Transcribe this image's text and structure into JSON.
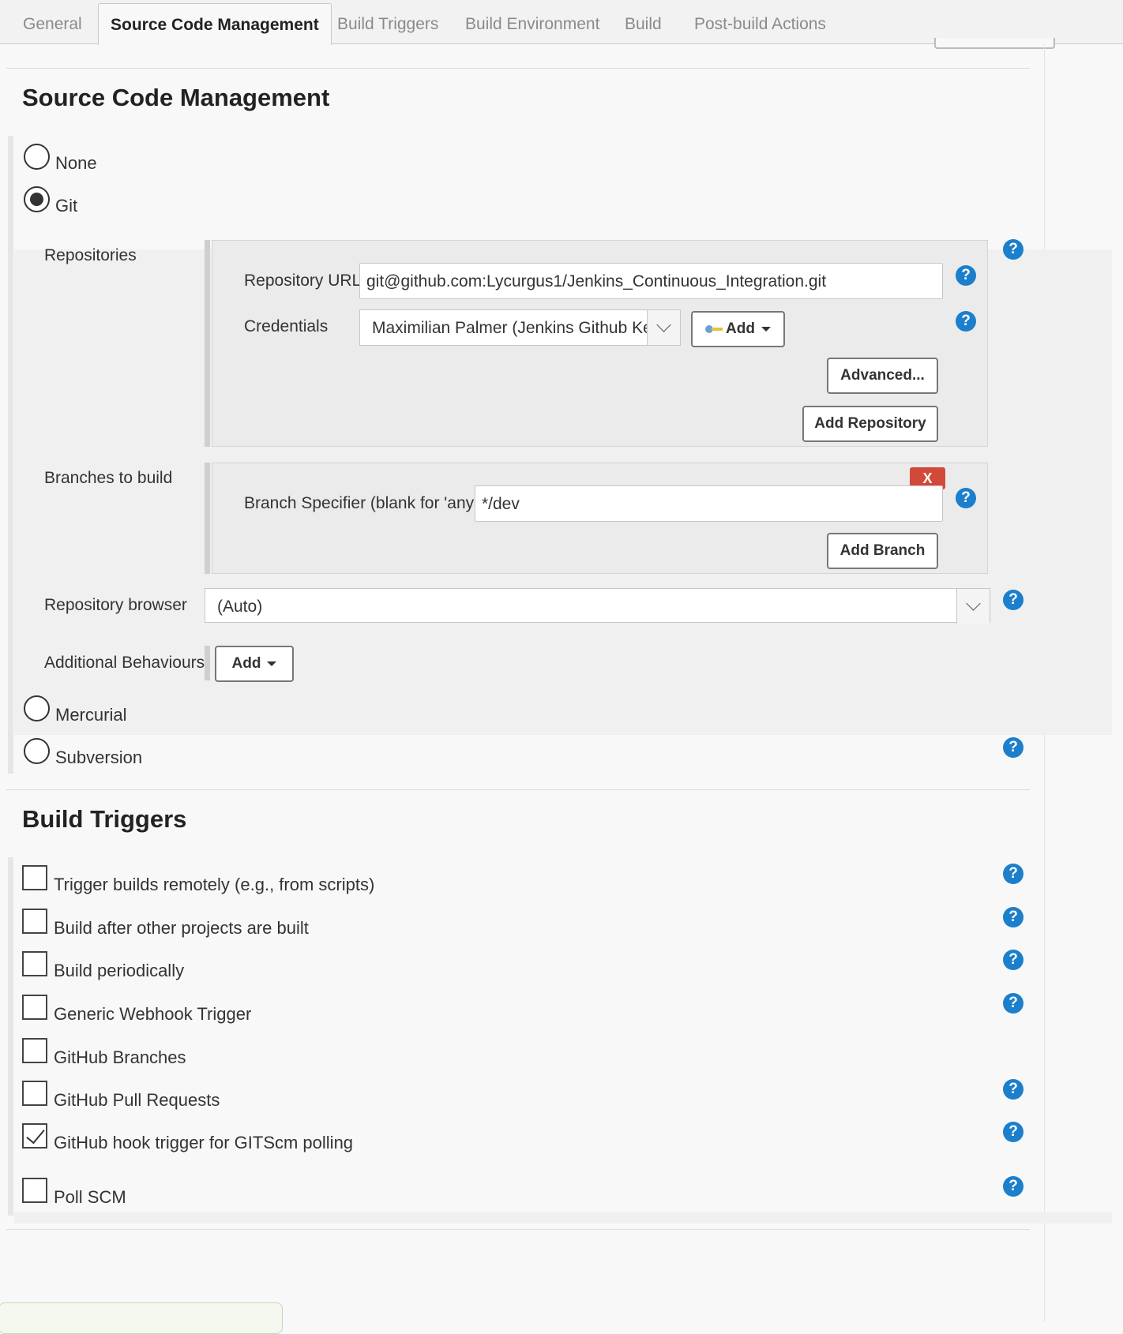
{
  "tabs": [
    {
      "label": "General"
    },
    {
      "label": "Source Code Management"
    },
    {
      "label": "Build Triggers"
    },
    {
      "label": "Build Environment"
    },
    {
      "label": "Build"
    },
    {
      "label": "Post-build Actions"
    }
  ],
  "scm": {
    "title": "Source Code Management",
    "options": {
      "none": "None",
      "git": "Git",
      "mercurial": "Mercurial",
      "subversion": "Subversion"
    },
    "selected": "Git",
    "repositories_label": "Repositories",
    "repository_url_label": "Repository URL",
    "repository_url_value": "git@github.com:Lycurgus1/Jenkins_Continuous_Integration.git",
    "credentials_label": "Credentials",
    "credentials_value": "Maximilian Palmer (Jenkins Github Key)",
    "credentials_add_label": "Add",
    "advanced_label": "Advanced...",
    "add_repository_label": "Add Repository",
    "branches_label": "Branches to build",
    "branch_specifier_label": "Branch Specifier (blank for 'any')",
    "branch_specifier_value": "*/dev",
    "delete_branch_label": "X",
    "add_branch_label": "Add Branch",
    "repository_browser_label": "Repository browser",
    "repository_browser_value": "(Auto)",
    "additional_behaviours_label": "Additional Behaviours",
    "additional_add_label": "Add"
  },
  "build_triggers": {
    "title": "Build Triggers",
    "items": [
      {
        "label": "Trigger builds remotely (e.g., from scripts)",
        "checked": false
      },
      {
        "label": "Build after other projects are built",
        "checked": false
      },
      {
        "label": "Build periodically",
        "checked": false
      },
      {
        "label": "Generic Webhook Trigger",
        "checked": false
      },
      {
        "label": "GitHub Branches",
        "checked": false
      },
      {
        "label": "GitHub Pull Requests",
        "checked": false
      },
      {
        "label": "GitHub hook trigger for GITScm polling",
        "checked": true
      },
      {
        "label": "Poll SCM",
        "checked": false
      }
    ]
  },
  "help_icon_glyph": "?",
  "colors": {
    "help_blue": "#1b7fcc",
    "delete_red": "#d24939",
    "active_tab_text": "#222222",
    "inactive_tab_text": "#8a8a8a"
  }
}
